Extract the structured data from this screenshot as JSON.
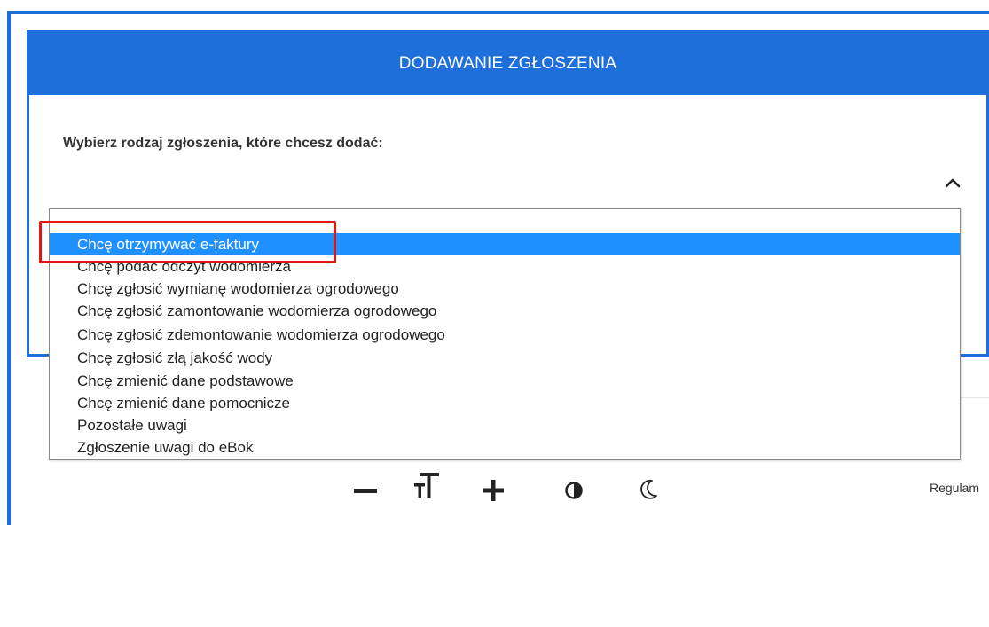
{
  "dialog": {
    "title": "DODAWANIE ZGŁOSZENIA",
    "prompt": "Wybierz rodzaj zgłoszenia, które chcesz dodać:"
  },
  "dropdown": {
    "selected_index": 0,
    "options": [
      "Chcę otrzymywać e-faktury",
      "Chcę podać odczyt wodomierza",
      "Chcę zgłosić wymianę wodomierza ogrodowego",
      "Chcę zgłosić zamontowanie wodomierza ogrodowego",
      "Chcę zgłosić zdemontowanie wodomierza ogrodowego",
      "Chcę zgłosić złą jakość wody",
      "Chcę zmienić dane podstawowe",
      "Chcę zmienić dane pomocnicze",
      "Pozostałe uwagi",
      "Zgłoszenie uwagi do eBok"
    ]
  },
  "toolbar": {
    "icons": [
      "minus-icon",
      "text-size-icon",
      "plus-icon",
      "contrast-icon",
      "moon-icon"
    ]
  },
  "footer": {
    "regulamin_label": "Regulam"
  },
  "colors": {
    "accent": "#1e6fd9",
    "selected": "#1e90ff",
    "highlight_box": "#e21414"
  }
}
